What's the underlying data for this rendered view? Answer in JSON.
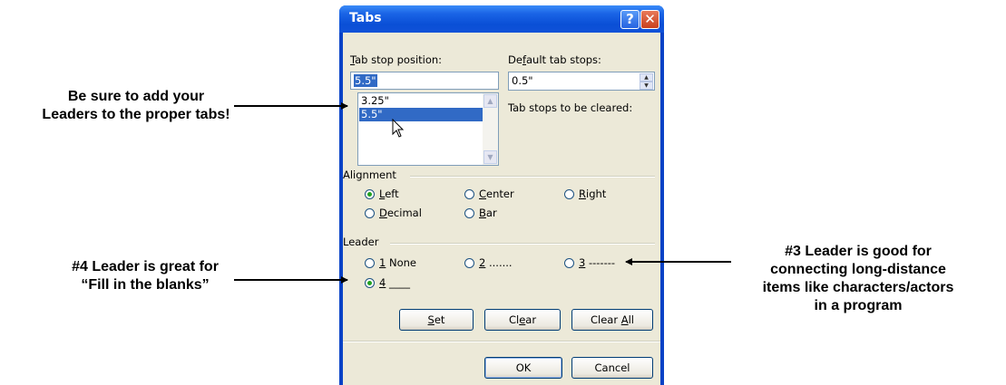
{
  "callouts": {
    "left_top": [
      "Be sure to add your",
      "Leaders to the proper tabs!"
    ],
    "left_bottom": [
      "#4 Leader is great for",
      "“Fill in the blanks”"
    ],
    "right": [
      "#3 Leader is good for",
      "connecting long-distance",
      "items like characters/actors",
      "in a program"
    ]
  },
  "dialog": {
    "title": "Tabs",
    "help_icon": "question-mark-icon",
    "close_icon": "close-x-icon",
    "tab_stop_position": {
      "label_u": "T",
      "label_rest": "ab stop position:",
      "value": "5.5\""
    },
    "tab_stop_list": [
      "3.25\"",
      "5.5\""
    ],
    "tab_stop_selected": "5.5\"",
    "default_tab_stops": {
      "label_pre": "De",
      "label_u": "f",
      "label_rest": "ault tab stops:",
      "value": "0.5\""
    },
    "tab_stops_cleared_label": "Tab stops to be cleared:",
    "alignment": {
      "label": "Alignment",
      "options": [
        {
          "u": "L",
          "rest": "eft",
          "selected": true
        },
        {
          "u": "C",
          "rest": "enter",
          "selected": false
        },
        {
          "u": "R",
          "rest": "ight",
          "selected": false
        },
        {
          "u": "D",
          "rest": "ecimal",
          "selected": false
        },
        {
          "u": "B",
          "rest": "ar",
          "selected": false
        }
      ]
    },
    "leader": {
      "label": "Leader",
      "options": [
        {
          "u": "1",
          "rest": " None",
          "selected": false
        },
        {
          "u": "2",
          "rest": " .......",
          "selected": false
        },
        {
          "u": "3",
          "rest": " -------",
          "selected": false
        },
        {
          "u": "4",
          "rest": " ____",
          "selected": true
        }
      ]
    },
    "buttons": {
      "set": {
        "u": "S",
        "rest": "et"
      },
      "clear": {
        "pre": "Cl",
        "u": "e",
        "rest": "ar"
      },
      "clear_all": {
        "pre": "Clear ",
        "u": "A",
        "rest": "ll"
      },
      "ok": "OK",
      "cancel": "Cancel"
    }
  }
}
